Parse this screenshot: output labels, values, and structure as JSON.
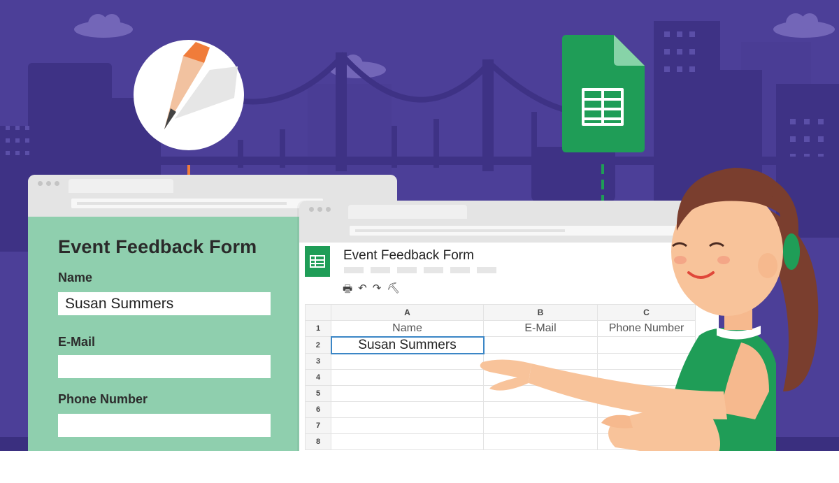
{
  "colors": {
    "background": "#4c3f98",
    "skyline": "#3e3285",
    "form_panel": "#8fcfae",
    "sheets_green": "#1f9d57",
    "pencil_orange": "#f07c3a",
    "active_cell_border": "#3b86c6"
  },
  "icons": [
    "pencil-app-icon",
    "google-sheets-icon",
    "print-icon",
    "undo-icon",
    "redo-icon",
    "paint-format-icon"
  ],
  "form": {
    "title": "Event Feedback Form",
    "fields": [
      {
        "label": "Name",
        "value": "Susan Summers"
      },
      {
        "label": "E-Mail",
        "value": ""
      },
      {
        "label": "Phone Number",
        "value": ""
      }
    ]
  },
  "sheet": {
    "title": "Event Feedback Form",
    "toolbar": {
      "print": "🖶",
      "undo": "↶",
      "redo": "↷",
      "paint_format": "⛏"
    },
    "columns": [
      "A",
      "B",
      "C"
    ],
    "rows": [
      {
        "num": "1",
        "cells": [
          "Name",
          "E-Mail",
          "Phone Number"
        ]
      },
      {
        "num": "2",
        "cells": [
          "Susan Summers",
          "",
          ""
        ]
      },
      {
        "num": "3",
        "cells": [
          "",
          "",
          ""
        ]
      },
      {
        "num": "4",
        "cells": [
          "",
          "",
          ""
        ]
      },
      {
        "num": "5",
        "cells": [
          "",
          "",
          ""
        ]
      },
      {
        "num": "6",
        "cells": [
          "",
          "",
          ""
        ]
      },
      {
        "num": "7",
        "cells": [
          "",
          "",
          ""
        ]
      },
      {
        "num": "8",
        "cells": [
          "",
          "",
          ""
        ]
      }
    ]
  }
}
